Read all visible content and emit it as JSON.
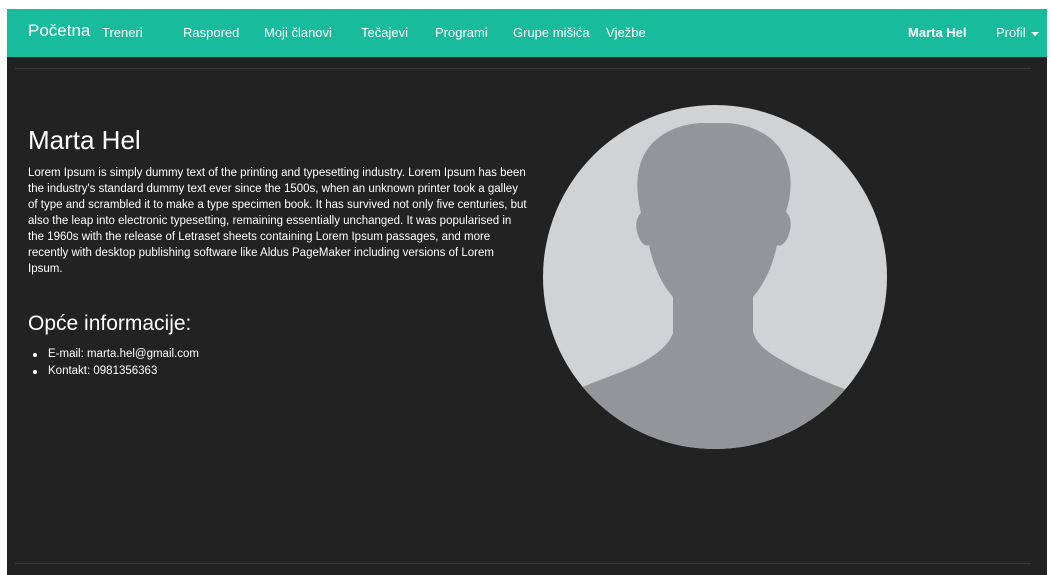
{
  "navbar": {
    "brand": "Početna",
    "links": [
      "Treneri",
      "Raspored",
      "Moji članovi",
      "Tečajevi",
      "Programi",
      "Grupe mišića",
      "Vježbe"
    ],
    "user": "Marta Hel",
    "profile_menu": "Profil",
    "accent_color": "#18bc9c"
  },
  "profile": {
    "name": "Marta Hel",
    "bio": "Lorem Ipsum is simply dummy text of the printing and typesetting industry. Lorem Ipsum has been the industry's standard dummy text ever since the 1500s, when an unknown printer took a galley of type and scrambled it to make a type specimen book. It has survived not only five centuries, but also the leap into electronic typesetting, remaining essentially unchanged. It was popularised in the 1960s with the release of Letraset sheets containing Lorem Ipsum passages, and more recently with desktop publishing software like Aldus PageMaker including versions of Lorem Ipsum.",
    "info_title": "Opće informacije:",
    "info": [
      "E-mail: marta.hel@gmail.com",
      "Kontakt: 0981356363"
    ],
    "avatar_icon": "user-silhouette-icon"
  }
}
